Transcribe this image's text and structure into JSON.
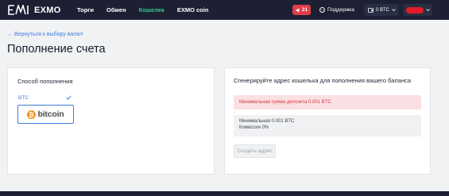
{
  "colors": {
    "nav_bg": "#1d2033",
    "accent_green": "#2fcc86",
    "link_blue": "#3d7ddb",
    "alert_red": "#d53745",
    "notification_red": "#e23d4a"
  },
  "header": {
    "logo_text": "EXMO",
    "logo_icon": "exmo-logo-icon",
    "nav": [
      {
        "label": "Торги"
      },
      {
        "label": "Обмен"
      },
      {
        "label": "Кошелек",
        "active": true
      },
      {
        "label": "EXMO coin"
      }
    ],
    "notifications": {
      "icon": "megaphone-icon",
      "count": "21"
    },
    "support": {
      "icon": "chat-icon",
      "label": "Поддержка"
    },
    "balance": {
      "icon": "wallet-icon",
      "label": "0 BTC"
    },
    "user": {
      "icon": "chevron-down-icon"
    }
  },
  "page": {
    "back_link": "← Вернуться к выбору валют",
    "title": "Пополнение счета"
  },
  "deposit_method": {
    "title": "Способ пополнения",
    "currency_code": "BTC",
    "check_icon": "checkmark-icon",
    "method_icon": "bitcoin-logo-icon",
    "method_label": "bitcoin"
  },
  "wallet_address": {
    "title": "Сгенерируйте адрес кошелька для пополнения вашего баланса",
    "alert": "Минимальная сумма депозита 0.001 BTC",
    "info": [
      "Минимальная 0.001 BTC",
      "Комиссия 0%"
    ],
    "button_label": "Создать адрес"
  }
}
